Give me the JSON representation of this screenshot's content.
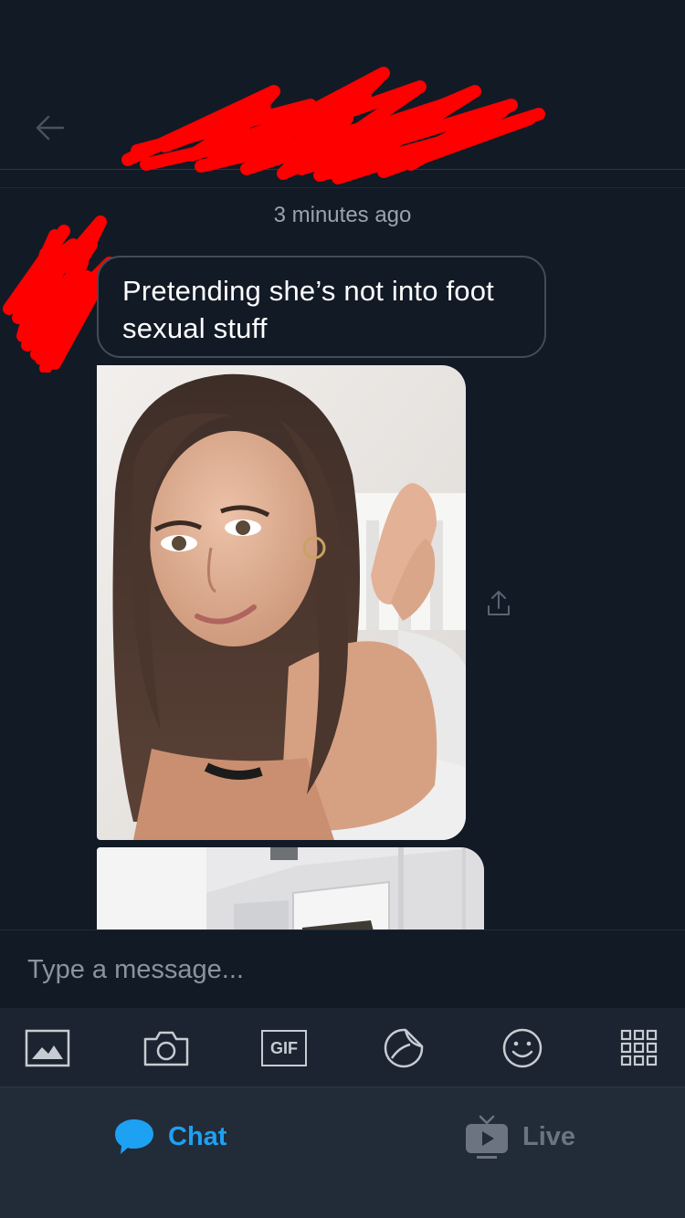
{
  "chat": {
    "timestamp": "3 minutes ago",
    "message": "Pretending she’s not into foot sexual stuff"
  },
  "compose": {
    "placeholder": "Type a message..."
  },
  "toolbar": {
    "gif_label": "GIF"
  },
  "tabs": {
    "chat_label": "Chat",
    "live_label": "Live"
  },
  "colors": {
    "background": "#121a26",
    "accent": "#1da1f2",
    "redaction": "#ff0000"
  }
}
